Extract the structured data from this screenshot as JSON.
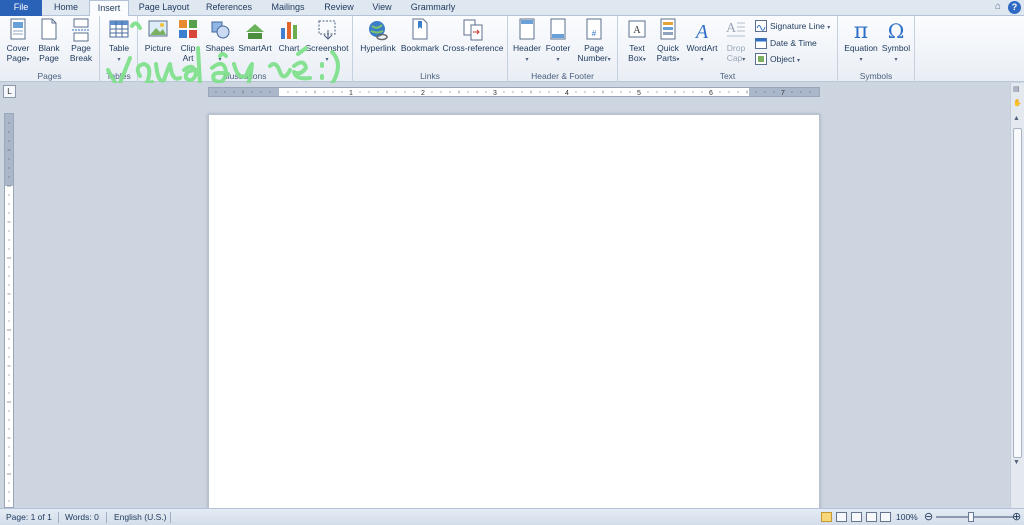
{
  "tabs": [
    {
      "id": "file",
      "label": "File"
    },
    {
      "id": "home",
      "label": "Home"
    },
    {
      "id": "insert",
      "label": "Insert"
    },
    {
      "id": "page-layout",
      "label": "Page Layout"
    },
    {
      "id": "references",
      "label": "References"
    },
    {
      "id": "mailings",
      "label": "Mailings"
    },
    {
      "id": "review",
      "label": "Review"
    },
    {
      "id": "view",
      "label": "View"
    },
    {
      "id": "grammarly",
      "label": "Grammarly"
    }
  ],
  "ribbon": {
    "groups": {
      "pages": "Pages",
      "tables": "Tables",
      "illustrations": "Illustrations",
      "links": "Links",
      "header_footer": "Header & Footer",
      "text": "Text",
      "symbols": "Symbols"
    },
    "buttons": {
      "cover_page": [
        "Cover",
        "Page"
      ],
      "blank_page": [
        "Blank",
        "Page"
      ],
      "page_break": [
        "Page",
        "Break"
      ],
      "table": [
        "Table"
      ],
      "picture": [
        "Picture"
      ],
      "clip_art": [
        "Clip",
        "Art"
      ],
      "shapes": [
        "Shapes"
      ],
      "smartart": [
        "SmartArt"
      ],
      "chart": [
        "Chart"
      ],
      "screenshot": [
        "Screenshot"
      ],
      "hyperlink": [
        "Hyperlink"
      ],
      "bookmark": [
        "Bookmark"
      ],
      "cross_reference": [
        "Cross-reference"
      ],
      "header": [
        "Header"
      ],
      "footer": [
        "Footer"
      ],
      "page_number": [
        "Page",
        "Number"
      ],
      "text_box": [
        "Text",
        "Box"
      ],
      "quick_parts": [
        "Quick",
        "Parts"
      ],
      "wordart": [
        "WordArt"
      ],
      "drop_cap": [
        "Drop",
        "Cap"
      ],
      "equation": [
        "Equation"
      ],
      "symbol": [
        "Symbol"
      ]
    },
    "small_buttons": {
      "signature_line": "Signature Line",
      "date_time": "Date & Time",
      "object": "Object"
    }
  },
  "ruler": {
    "ticks": [
      "1",
      "2",
      "3",
      "4",
      "5",
      "6",
      "7"
    ],
    "corner": "L"
  },
  "status": {
    "page": "Page: 1 of 1",
    "words": "Words: 0",
    "language": "English (U.S.)",
    "zoom": "100%"
  },
  "colors": {
    "file_tab": "#2a62b8",
    "scribble": "#7ee08a"
  }
}
